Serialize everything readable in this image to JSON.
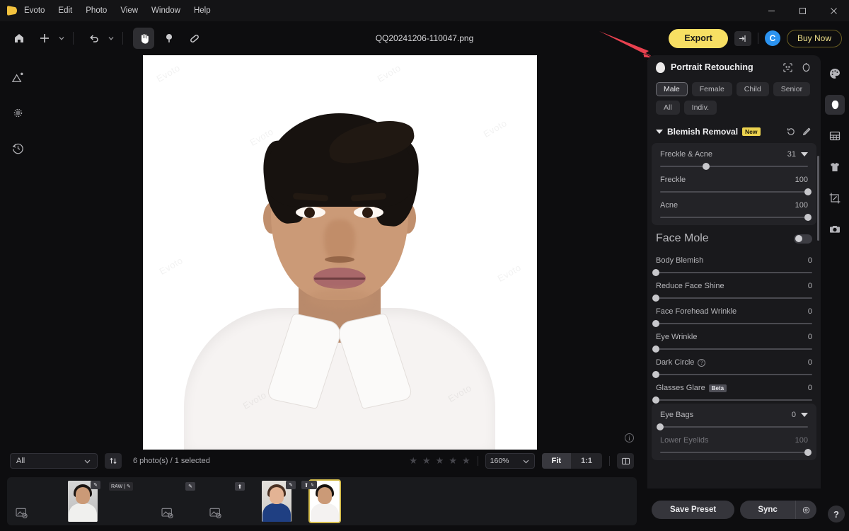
{
  "app": {
    "name": "Evoto",
    "menu": [
      "Evoto",
      "Edit",
      "Photo",
      "View",
      "Window",
      "Help"
    ],
    "document_title": "QQ20241206-110047.png"
  },
  "window_controls": {
    "minimize": "minimize-icon",
    "maximize": "maximize-icon",
    "close": "close-icon"
  },
  "toolbar": {
    "home": "home-icon",
    "add": "plus-icon",
    "add_caret": "chevron-down-icon",
    "undo": "undo-icon",
    "undo_caret": "chevron-down-icon",
    "hand": "hand-tool-icon",
    "retouch": "blemish-tool-icon",
    "bandage": "bandage-tool-icon"
  },
  "header_actions": {
    "export_label": "Export",
    "share_icon": "share-export-icon",
    "avatar_initial": "C",
    "buy_label": "Buy Now",
    "export_color": "#f7df63",
    "avatar_color": "#2b93f0"
  },
  "left_rail": [
    {
      "name": "image-adjust-icon"
    },
    {
      "name": "effects-icon"
    },
    {
      "name": "history-icon"
    }
  ],
  "right_rail": [
    {
      "name": "palette-icon",
      "active": false
    },
    {
      "name": "portrait-face-icon",
      "active": true
    },
    {
      "name": "background-grid-icon",
      "active": false
    },
    {
      "name": "clothing-icon",
      "active": false
    },
    {
      "name": "crop-icon",
      "active": false
    },
    {
      "name": "camera-icon",
      "active": false
    }
  ],
  "canvas": {
    "watermark_text": "Evoto",
    "info_icon": "info-icon"
  },
  "panel": {
    "title": "Portrait Retouching",
    "header_icons": [
      "face-detect-icon",
      "reset-face-icon"
    ],
    "chips": [
      {
        "label": "Male",
        "selected": true
      },
      {
        "label": "Female",
        "selected": false
      },
      {
        "label": "Child",
        "selected": false
      },
      {
        "label": "Senior",
        "selected": false
      },
      {
        "label": "All",
        "selected": false
      },
      {
        "label": "Indiv.",
        "selected": false
      }
    ],
    "section": {
      "title": "Blemish Removal",
      "badge": "New",
      "reset_icon": "reset-icon",
      "edit_icon": "brush-edit-icon"
    },
    "sliders": [
      {
        "label": "Freckle & Acne",
        "value": "31",
        "percent": 31,
        "has_caret": true,
        "group": "a"
      },
      {
        "label": "Freckle",
        "value": "100",
        "percent": 100,
        "has_caret": false,
        "group": "a"
      },
      {
        "label": "Acne",
        "value": "100",
        "percent": 100,
        "has_caret": false,
        "group": "a"
      },
      {
        "label": "Body Blemish",
        "value": "0",
        "percent": 0,
        "has_caret": false,
        "group": ""
      },
      {
        "label": "Reduce Face Shine",
        "value": "0",
        "percent": 0,
        "has_caret": false,
        "group": ""
      },
      {
        "label": "Face Forehead Wrinkle",
        "value": "0",
        "percent": 0,
        "has_caret": false,
        "group": ""
      },
      {
        "label": "Eye Wrinkle",
        "value": "0",
        "percent": 0,
        "has_caret": false,
        "group": ""
      },
      {
        "label": "Dark Circle",
        "value": "0",
        "percent": 0,
        "has_caret": false,
        "help": true,
        "group": ""
      },
      {
        "label": "Glasses Glare",
        "value": "0",
        "percent": 0,
        "has_caret": false,
        "badge": "Beta",
        "group": ""
      },
      {
        "label": "Eye Bags",
        "value": "0",
        "percent": 0,
        "has_caret": true,
        "group": "b"
      },
      {
        "label": "Lower Eyelids",
        "value": "100",
        "percent": 100,
        "has_caret": false,
        "group": "b",
        "dim": true
      }
    ],
    "toggle_row": {
      "label": "Face Mole",
      "on": false
    },
    "footer": {
      "save_preset_label": "Save Preset",
      "sync_label": "Sync",
      "sync_gear_icon": "gear-icon",
      "help_label": "?"
    }
  },
  "bottom_bar": {
    "filter_value": "All",
    "filter_caret": "chevron-down-icon",
    "sort_icon": "sort-icon",
    "count_text": "6 photo(s) / 1 selected",
    "stars": 5,
    "zoom_value": "160%",
    "zoom_caret": "chevron-down-icon",
    "fit_label": "Fit",
    "one_to_one_label": "1:1",
    "split_view_icon": "split-view-icon"
  },
  "filmstrip": [
    {
      "name": "placeholder-thumb-1",
      "kind": "placeholder",
      "selected": false,
      "pencil": false,
      "raw": false,
      "upload": false
    },
    {
      "name": "photo-thumb-man-white-tshirt",
      "kind": "photo",
      "variant": "tshirt",
      "selected": false,
      "pencil": true,
      "raw": false,
      "upload": false
    },
    {
      "name": "raw-tag-item",
      "kind": "rawtag",
      "raw_label": "RAW",
      "pencil": true,
      "selected": false
    },
    {
      "name": "placeholder-thumb-2",
      "kind": "placeholder",
      "selected": false,
      "pencil": true,
      "raw": false,
      "upload": false
    },
    {
      "name": "placeholder-thumb-3",
      "kind": "placeholder",
      "selected": false,
      "pencil": false,
      "raw": false,
      "upload": true
    },
    {
      "name": "photo-thumb-man-blue-suit",
      "kind": "photo",
      "variant": "suit",
      "selected": false,
      "pencil": true,
      "raw": false,
      "upload": true
    },
    {
      "name": "photo-thumb-man-white-shirt",
      "kind": "photo",
      "variant": "shirt",
      "selected": true,
      "pencil": true,
      "raw": false,
      "upload": false
    }
  ],
  "annotation": {
    "arrow_color": "#e8414f",
    "name": "red-pointer-arrow"
  }
}
